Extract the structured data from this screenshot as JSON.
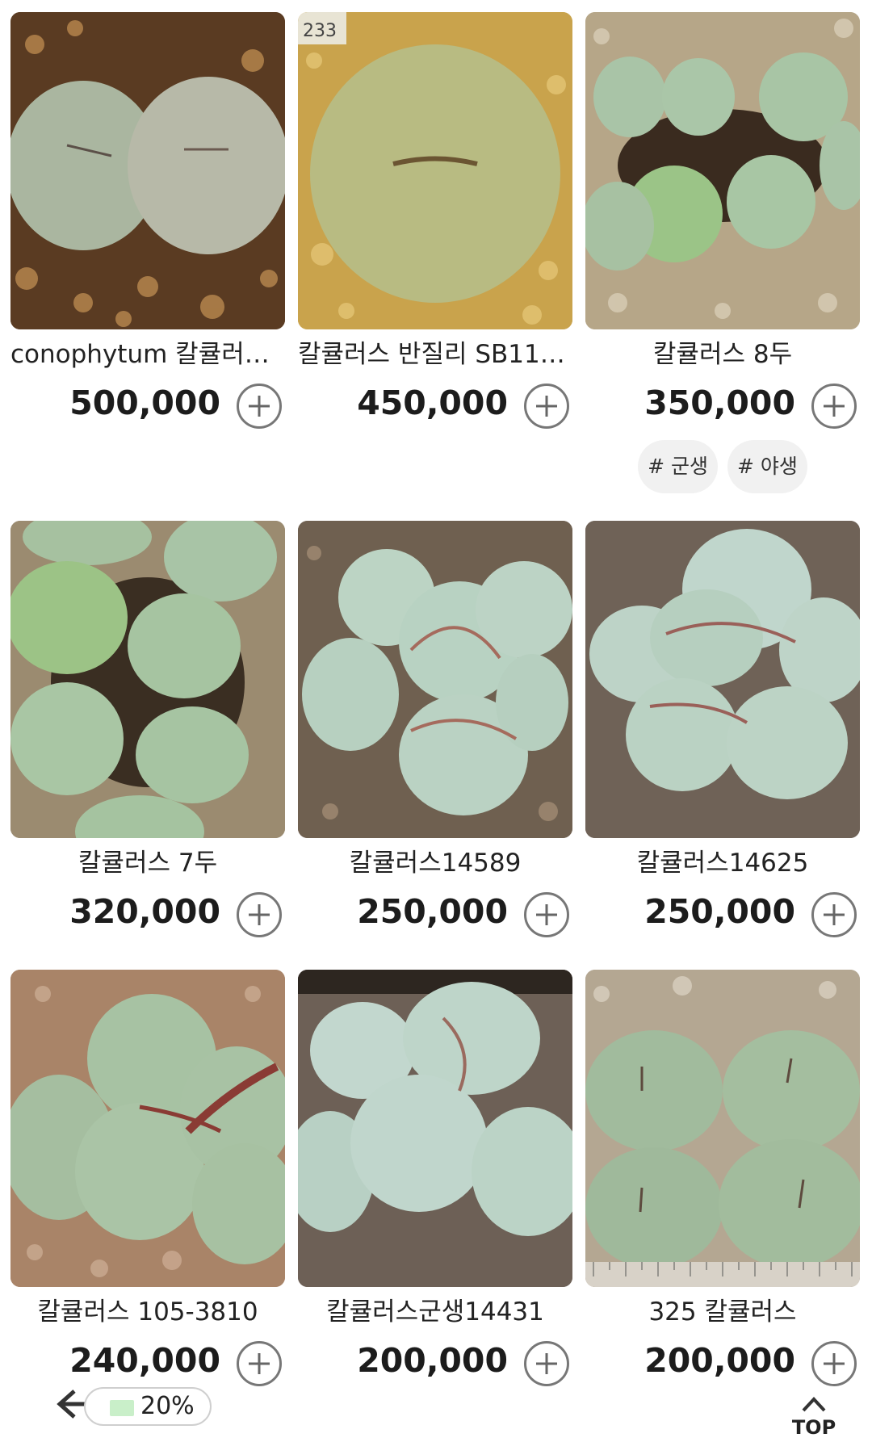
{
  "products": [
    {
      "name": "conophytum 칼큘러…",
      "price": "500,000",
      "tags": []
    },
    {
      "name": "칼큘러스 반질리 SB11…",
      "price": "450,000",
      "tags": []
    },
    {
      "name": "칼큘러스 8두",
      "price": "350,000",
      "tags": [
        "# 군생",
        "# 야생"
      ]
    },
    {
      "name": "칼큘러스 7두",
      "price": "320,000",
      "tags": []
    },
    {
      "name": "칼큘러스14589",
      "price": "250,000",
      "tags": []
    },
    {
      "name": "칼큘러스14625",
      "price": "250,000",
      "tags": []
    },
    {
      "name": "칼큘러스 105-3810",
      "price": "240,000",
      "tags": []
    },
    {
      "name": "칼큘러스군생14431",
      "price": "200,000",
      "tags": []
    },
    {
      "name": "325 칼큘러스",
      "price": "200,000",
      "tags": []
    }
  ],
  "image_labels": {
    "p2_badge": "233"
  },
  "bottom_bar": {
    "progress_text": "20%",
    "top_label": "TOP"
  },
  "icons": {
    "add": "plus-circle-icon",
    "back": "arrow-left-icon",
    "top": "chevron-up-icon"
  }
}
